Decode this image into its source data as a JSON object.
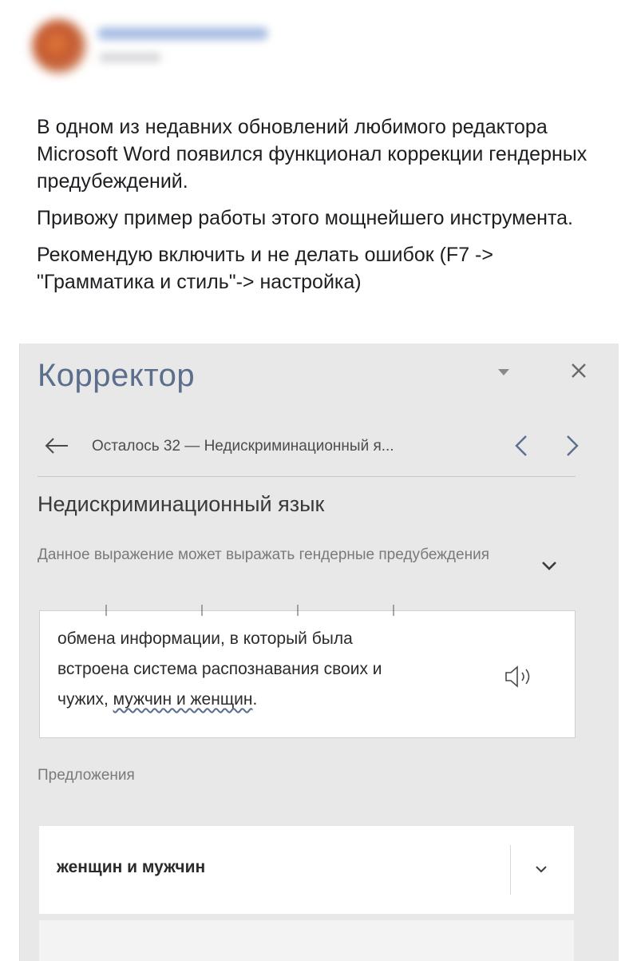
{
  "post": {
    "paragraphs": [
      "В одном из недавних обновлений любимого редактора Microsoft Word появился функционал коррекции гендерных предубеждений.",
      "Привожу пример работы этого мощнейшего инструмента.",
      "Рекомендую включить и не делать ошибок (F7 -> \"Грамматика и стиль\"-> настройка)"
    ]
  },
  "panel": {
    "title": "Корректор",
    "nav_text": "Осталось 32 — Недискриминационный я...",
    "section_title": "Недискриминационный язык",
    "section_description": "Данное выражение может выражать гендерные предубеждения",
    "context": {
      "line1": "обмена информации, в который была",
      "line2": "встроена система распознавания своих и",
      "line3_start": "чужих, ",
      "flagged": "мужчин и женщин",
      "line3_end": "."
    },
    "suggestions_label": "Предложения",
    "suggestion": "женщин и мужчин"
  },
  "colors": {
    "panel_bg": "#e8e8e8",
    "title_accent": "#5b6e8c",
    "card_bg": "#ffffff"
  },
  "icons": {
    "dropdown": "chevron-down-icon",
    "close": "close-icon",
    "back": "arrow-left-icon",
    "prev": "chevron-left-icon",
    "next": "chevron-right-icon",
    "speaker": "speaker-icon",
    "expand": "chevron-down-icon"
  }
}
